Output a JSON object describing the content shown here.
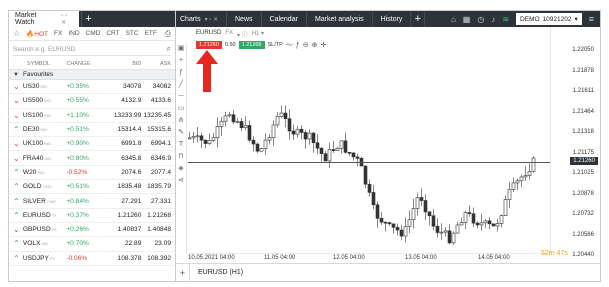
{
  "market_watch": {
    "title": "Market Watch",
    "filters": [
      "HOT",
      "FX",
      "IND",
      "CMD",
      "CRT",
      "STC",
      "ETF"
    ],
    "search_placeholder": "Search e.g. EURUSD",
    "columns": {
      "symbol": "SYMBOL",
      "change": "CHANGE",
      "bid": "BID",
      "ask": "ASK"
    },
    "group": "Favourites",
    "rows": [
      {
        "dir": "down",
        "symbol": "US30",
        "tag": "IND",
        "change": "+0.35%",
        "bid": "34078",
        "ask": "34082"
      },
      {
        "dir": "down",
        "symbol": "US500",
        "tag": "IND",
        "change": "+0.55%",
        "bid": "4132.9",
        "ask": "4133.6"
      },
      {
        "dir": "down",
        "symbol": "US100",
        "tag": "IND",
        "change": "+1.10%",
        "bid": "13233.99",
        "ask": "13235.45"
      },
      {
        "dir": "up",
        "symbol": "DE30",
        "tag": "IND",
        "change": "+0.51%",
        "bid": "15314.4",
        "ask": "15315.6"
      },
      {
        "dir": "down",
        "symbol": "UK100",
        "tag": "IND",
        "change": "+0.90%",
        "bid": "6991.8",
        "ask": "6994.1"
      },
      {
        "dir": "down",
        "symbol": "FRA40",
        "tag": "IND",
        "change": "+0.80%",
        "bid": "6345.8",
        "ask": "6346.9"
      },
      {
        "dir": "up",
        "symbol": "W20",
        "tag": "IND",
        "change": "-0.52%",
        "bid": "2074.6",
        "ask": "2077.4"
      },
      {
        "dir": "up",
        "symbol": "GOLD",
        "tag": "CMD",
        "change": "+0.51%",
        "bid": "1835.48",
        "ask": "1835.79"
      },
      {
        "dir": "up",
        "symbol": "SILVER",
        "tag": "CMD",
        "change": "+0.84%",
        "bid": "27.291",
        "ask": "27.331"
      },
      {
        "dir": "up",
        "symbol": "EURUSD",
        "tag": "FX",
        "change": "+0.37%",
        "bid": "1.21260",
        "ask": "1.21268"
      },
      {
        "dir": "down",
        "symbol": "GBPUSD",
        "tag": "FX",
        "change": "+0.26%",
        "bid": "1.40837",
        "ask": "1.40848"
      },
      {
        "dir": "up",
        "symbol": "VOLX",
        "tag": "IND",
        "change": "+0.70%",
        "bid": "22.89",
        "ask": "23.09"
      },
      {
        "dir": "up",
        "symbol": "USDJPY",
        "tag": "FX",
        "change": "-0.06%",
        "bid": "108.378",
        "ask": "108.392"
      }
    ]
  },
  "topbar": {
    "charts_label": "Charts",
    "tabs": [
      "News",
      "Calendar",
      "Market analysis",
      "History"
    ],
    "account_type": "DEMO",
    "account_id": "10921202"
  },
  "chart": {
    "symbol": "EURUSD",
    "instrument_tag": "FX",
    "timeframe": "H1",
    "sell_price": "1.21260",
    "quantity": "0.50",
    "buy_price": "1.21268",
    "sltp": "SL/TP",
    "y_ticks": [
      "1.22050",
      "1.21878",
      "1.21611",
      "1.21464",
      "1.21318",
      "1.21175",
      "1.21025",
      "1.20878",
      "1.20732",
      "1.20586",
      "1.20440"
    ],
    "current_price": "1.21260",
    "x_ticks": [
      "10.05.2021 04:00",
      "11.05 04:00",
      "12.05 04:00",
      "13.05 04:00",
      "14.05 04:00"
    ],
    "timer": "52m 47s",
    "footer_label": "EURUSD (H1)"
  }
}
